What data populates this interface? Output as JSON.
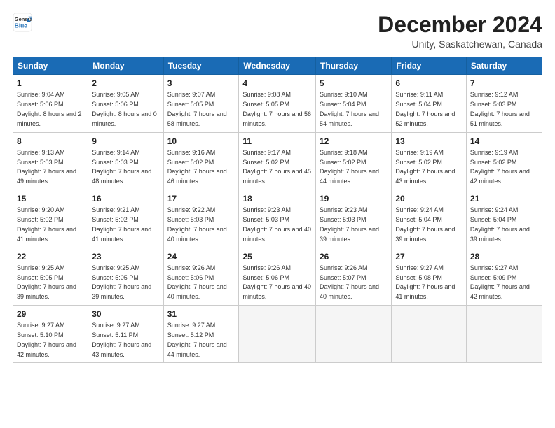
{
  "logo": {
    "line1": "General",
    "line2": "Blue"
  },
  "title": "December 2024",
  "subtitle": "Unity, Saskatchewan, Canada",
  "header_days": [
    "Sunday",
    "Monday",
    "Tuesday",
    "Wednesday",
    "Thursday",
    "Friday",
    "Saturday"
  ],
  "weeks": [
    [
      {
        "day": "1",
        "sunrise": "9:04 AM",
        "sunset": "5:06 PM",
        "daylight": "8 hours and 2 minutes."
      },
      {
        "day": "2",
        "sunrise": "9:05 AM",
        "sunset": "5:06 PM",
        "daylight": "8 hours and 0 minutes."
      },
      {
        "day": "3",
        "sunrise": "9:07 AM",
        "sunset": "5:05 PM",
        "daylight": "7 hours and 58 minutes."
      },
      {
        "day": "4",
        "sunrise": "9:08 AM",
        "sunset": "5:05 PM",
        "daylight": "7 hours and 56 minutes."
      },
      {
        "day": "5",
        "sunrise": "9:10 AM",
        "sunset": "5:04 PM",
        "daylight": "7 hours and 54 minutes."
      },
      {
        "day": "6",
        "sunrise": "9:11 AM",
        "sunset": "5:04 PM",
        "daylight": "7 hours and 52 minutes."
      },
      {
        "day": "7",
        "sunrise": "9:12 AM",
        "sunset": "5:03 PM",
        "daylight": "7 hours and 51 minutes."
      }
    ],
    [
      {
        "day": "8",
        "sunrise": "9:13 AM",
        "sunset": "5:03 PM",
        "daylight": "7 hours and 49 minutes."
      },
      {
        "day": "9",
        "sunrise": "9:14 AM",
        "sunset": "5:03 PM",
        "daylight": "7 hours and 48 minutes."
      },
      {
        "day": "10",
        "sunrise": "9:16 AM",
        "sunset": "5:02 PM",
        "daylight": "7 hours and 46 minutes."
      },
      {
        "day": "11",
        "sunrise": "9:17 AM",
        "sunset": "5:02 PM",
        "daylight": "7 hours and 45 minutes."
      },
      {
        "day": "12",
        "sunrise": "9:18 AM",
        "sunset": "5:02 PM",
        "daylight": "7 hours and 44 minutes."
      },
      {
        "day": "13",
        "sunrise": "9:19 AM",
        "sunset": "5:02 PM",
        "daylight": "7 hours and 43 minutes."
      },
      {
        "day": "14",
        "sunrise": "9:19 AM",
        "sunset": "5:02 PM",
        "daylight": "7 hours and 42 minutes."
      }
    ],
    [
      {
        "day": "15",
        "sunrise": "9:20 AM",
        "sunset": "5:02 PM",
        "daylight": "7 hours and 41 minutes."
      },
      {
        "day": "16",
        "sunrise": "9:21 AM",
        "sunset": "5:02 PM",
        "daylight": "7 hours and 41 minutes."
      },
      {
        "day": "17",
        "sunrise": "9:22 AM",
        "sunset": "5:03 PM",
        "daylight": "7 hours and 40 minutes."
      },
      {
        "day": "18",
        "sunrise": "9:23 AM",
        "sunset": "5:03 PM",
        "daylight": "7 hours and 40 minutes."
      },
      {
        "day": "19",
        "sunrise": "9:23 AM",
        "sunset": "5:03 PM",
        "daylight": "7 hours and 39 minutes."
      },
      {
        "day": "20",
        "sunrise": "9:24 AM",
        "sunset": "5:04 PM",
        "daylight": "7 hours and 39 minutes."
      },
      {
        "day": "21",
        "sunrise": "9:24 AM",
        "sunset": "5:04 PM",
        "daylight": "7 hours and 39 minutes."
      }
    ],
    [
      {
        "day": "22",
        "sunrise": "9:25 AM",
        "sunset": "5:05 PM",
        "daylight": "7 hours and 39 minutes."
      },
      {
        "day": "23",
        "sunrise": "9:25 AM",
        "sunset": "5:05 PM",
        "daylight": "7 hours and 39 minutes."
      },
      {
        "day": "24",
        "sunrise": "9:26 AM",
        "sunset": "5:06 PM",
        "daylight": "7 hours and 40 minutes."
      },
      {
        "day": "25",
        "sunrise": "9:26 AM",
        "sunset": "5:06 PM",
        "daylight": "7 hours and 40 minutes."
      },
      {
        "day": "26",
        "sunrise": "9:26 AM",
        "sunset": "5:07 PM",
        "daylight": "7 hours and 40 minutes."
      },
      {
        "day": "27",
        "sunrise": "9:27 AM",
        "sunset": "5:08 PM",
        "daylight": "7 hours and 41 minutes."
      },
      {
        "day": "28",
        "sunrise": "9:27 AM",
        "sunset": "5:09 PM",
        "daylight": "7 hours and 42 minutes."
      }
    ],
    [
      {
        "day": "29",
        "sunrise": "9:27 AM",
        "sunset": "5:10 PM",
        "daylight": "7 hours and 42 minutes."
      },
      {
        "day": "30",
        "sunrise": "9:27 AM",
        "sunset": "5:11 PM",
        "daylight": "7 hours and 43 minutes."
      },
      {
        "day": "31",
        "sunrise": "9:27 AM",
        "sunset": "5:12 PM",
        "daylight": "7 hours and 44 minutes."
      },
      null,
      null,
      null,
      null
    ]
  ]
}
